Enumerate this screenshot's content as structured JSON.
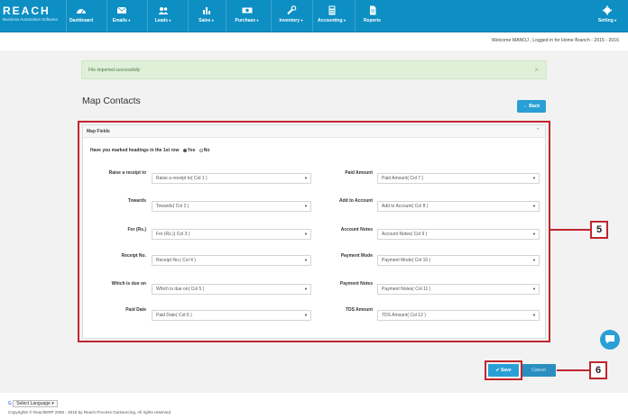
{
  "app": {
    "brand": "REACH",
    "tagline": "Business Automation Software"
  },
  "nav": [
    {
      "label": "Dashboard",
      "icon": "dashboard-icon",
      "dropdown": false
    },
    {
      "label": "Emails",
      "icon": "envelope-icon",
      "dropdown": true
    },
    {
      "label": "Leads",
      "icon": "users-icon",
      "dropdown": true
    },
    {
      "label": "Sales",
      "icon": "bar-chart-icon",
      "dropdown": true
    },
    {
      "label": "Purchase",
      "icon": "money-icon",
      "dropdown": true
    },
    {
      "label": "Inventory",
      "icon": "wrench-icon",
      "dropdown": true
    },
    {
      "label": "Accounting",
      "icon": "calculator-icon",
      "dropdown": true
    },
    {
      "label": "Reports",
      "icon": "document-icon",
      "dropdown": false
    }
  ],
  "settings_label": "Setting",
  "welcome": "Welcome MANOJ , Logged in for Home Branch - 2015 - 2016",
  "alert": {
    "text": "File imported successfully"
  },
  "page": {
    "title": "Map Contacts",
    "back_label": "Back"
  },
  "panel": {
    "title": "Map Fields",
    "question": "Have you marked headings in the 1st row",
    "yes": "Yes",
    "no": "No",
    "left_fields": [
      {
        "label": "Raise a receipt to",
        "value": "Raise a receipt to( Col 1 )"
      },
      {
        "label": "Towards",
        "value": "Towards( Col 2 )"
      },
      {
        "label": "For (Rs.)",
        "value": "For (Rs.)( Col 3 )"
      },
      {
        "label": "Receipt No.",
        "value": "Receipt No.( Col 4 )"
      },
      {
        "label": "Which is due on",
        "value": "Which is due on( Col 5 )"
      },
      {
        "label": "Paid Date",
        "value": "Paid Date( Col 6 )"
      }
    ],
    "right_fields": [
      {
        "label": "Paid Amount",
        "value": "Paid Amount( Col 7 )"
      },
      {
        "label": "Add to Account",
        "value": "Add to Account( Col 8 )"
      },
      {
        "label": "Account Notes",
        "value": "Account Notes( Col 9 )"
      },
      {
        "label": "Payment Mode",
        "value": "Payment Mode( Col 10 )"
      },
      {
        "label": "Payment Notes",
        "value": "Payment Notes( Col 11 )"
      },
      {
        "label": "TDS Amount",
        "value": "TDS Amount( Col 12 )"
      }
    ]
  },
  "buttons": {
    "save": "Save",
    "cancel": "Cancel"
  },
  "callouts": {
    "five": "5",
    "six": "6"
  },
  "footer": {
    "language": "Select Language",
    "copyright": "Copyrights © ReachERP 2006 - 2016 by Reach Process Outsourcing. All rights reserved"
  },
  "colors": {
    "accent": "#0e8fc4",
    "button": "#2a9fd6",
    "annotation": "#c0262d",
    "success_bg": "#dff0d8"
  }
}
